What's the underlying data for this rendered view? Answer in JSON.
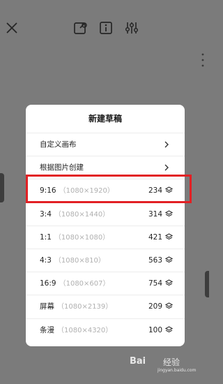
{
  "toolbar": {
    "close_icon": "close-icon",
    "draft_icon": "draft-edit-icon",
    "info_icon": "info-icon",
    "adjust_icon": "sliders-icon"
  },
  "dialog": {
    "title": "新建草稿",
    "options": [
      {
        "label": "自定义画布"
      },
      {
        "label": "根据图片创建"
      }
    ],
    "presets": [
      {
        "ratio": "9:16",
        "size": "（1080×1920）",
        "count": "234"
      },
      {
        "ratio": "3:4",
        "size": "（1080×1440）",
        "count": "314"
      },
      {
        "ratio": "1:1",
        "size": "（1080×1080）",
        "count": "421"
      },
      {
        "ratio": "4:3",
        "size": "（1080×810）",
        "count": "563"
      },
      {
        "ratio": "16:9",
        "size": "（1080×607）",
        "count": "754"
      },
      {
        "ratio": "屏幕",
        "size": "（1080×2139）",
        "count": "209"
      },
      {
        "ratio": "条漫",
        "size": "（1080×4320）",
        "count": "100"
      }
    ]
  },
  "watermark": {
    "logo": "Bai",
    "brand": "经验",
    "url": "jingyan.baidu.com"
  },
  "colors": {
    "highlight": "#e22024",
    "overlay": "#7b7b7b"
  }
}
